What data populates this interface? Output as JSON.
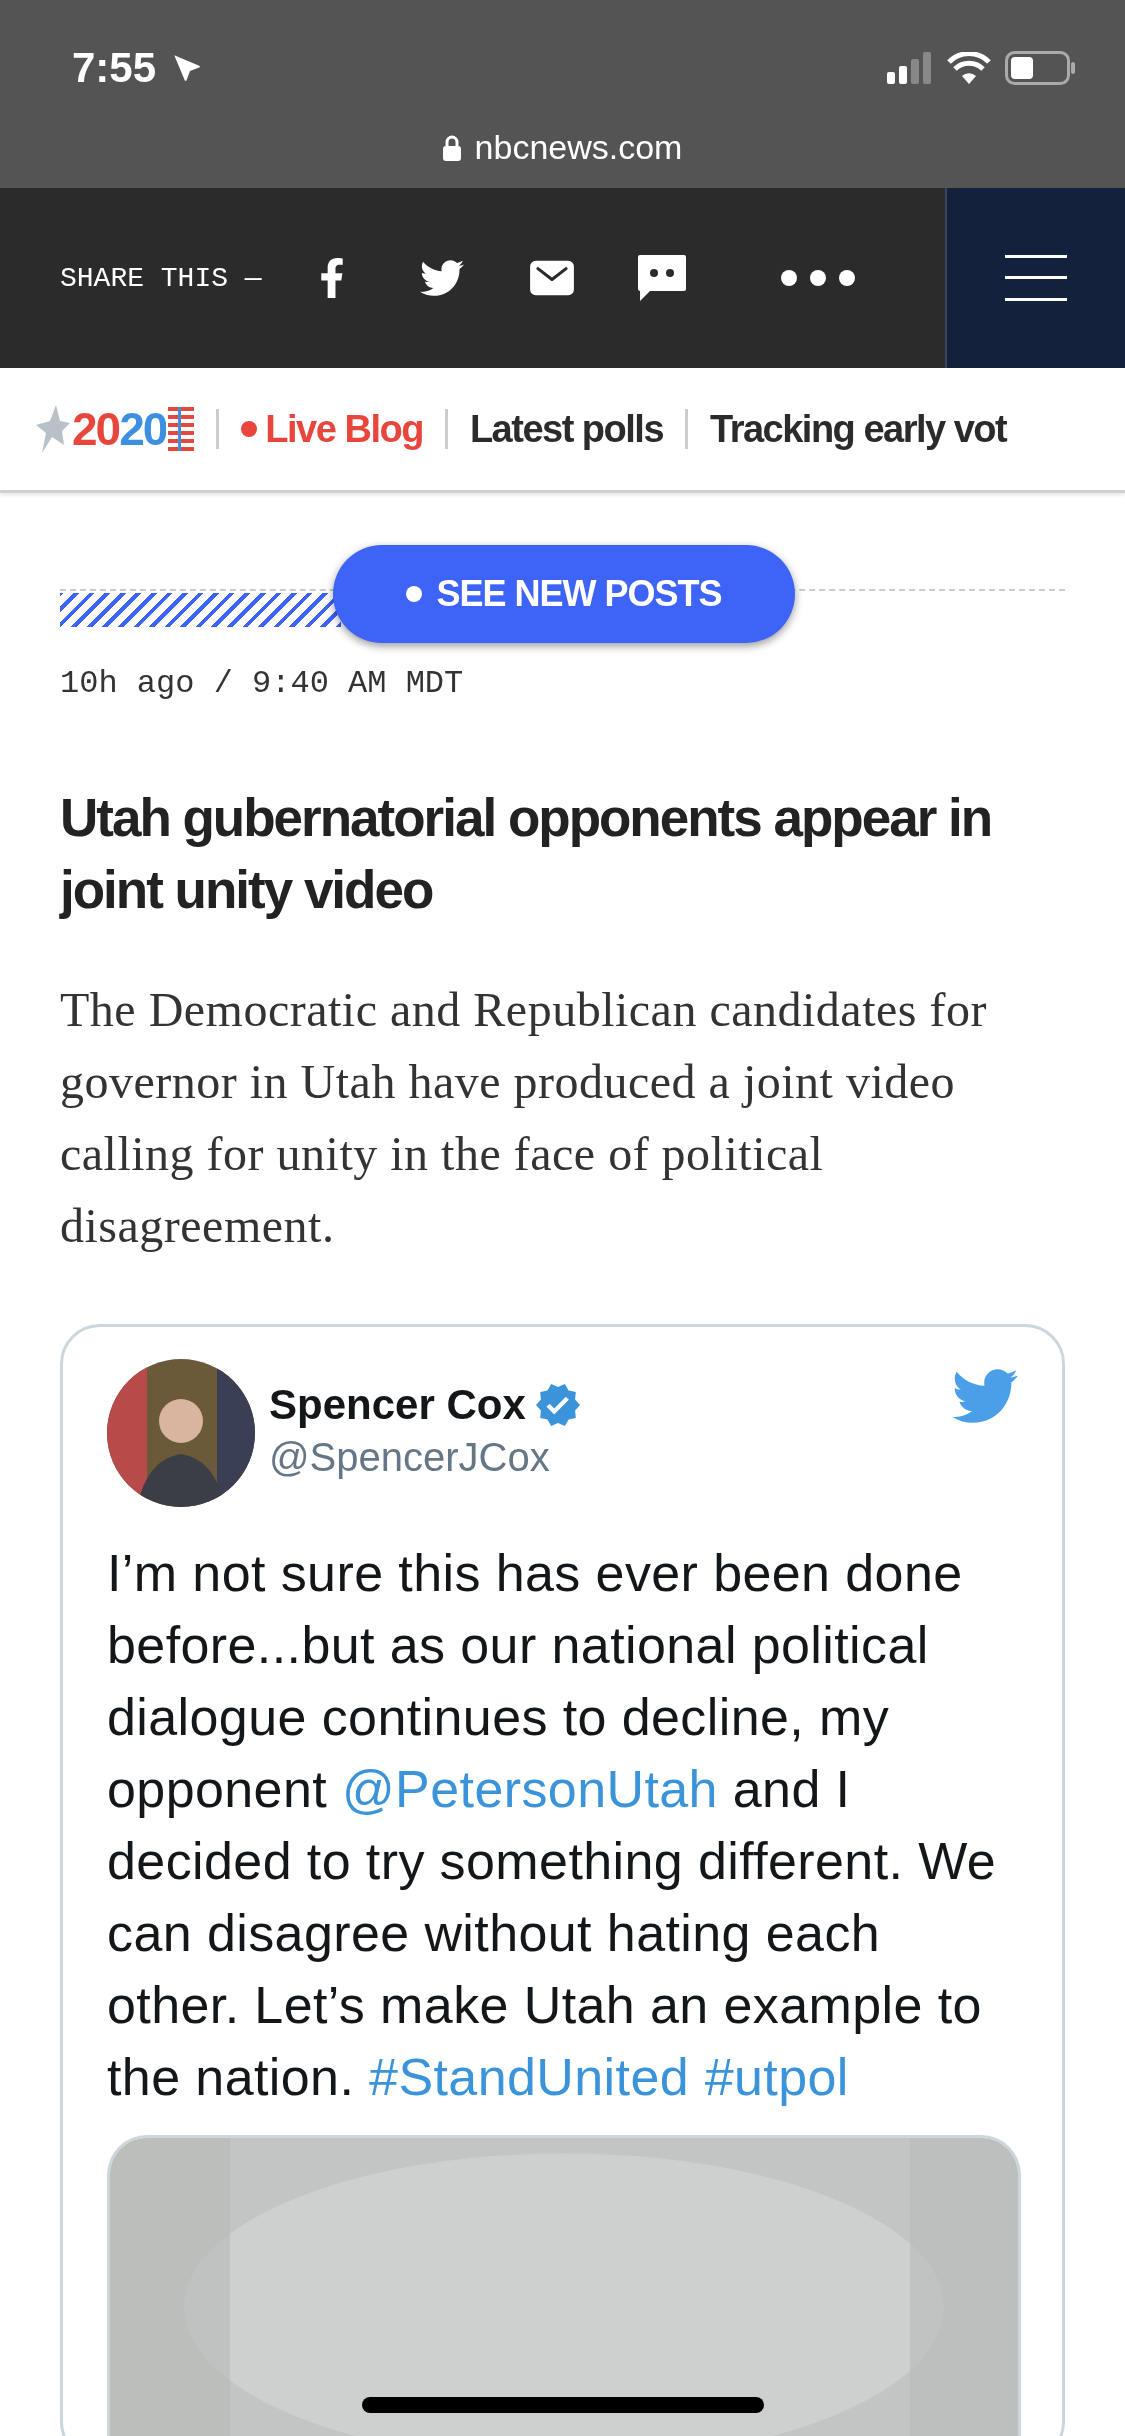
{
  "status_bar": {
    "time": "7:55",
    "url": "nbcnews.com"
  },
  "share_bar": {
    "label": "SHARE THIS —"
  },
  "nav": {
    "logo": "2020",
    "items": [
      {
        "label": "Live Blog",
        "kind": "live"
      },
      {
        "label": "Latest polls",
        "kind": "link"
      },
      {
        "label": "Tracking early vot",
        "kind": "link"
      }
    ]
  },
  "reading_progress": {
    "level": 0.28
  },
  "new_posts_button": "SEE NEW POSTS",
  "post": {
    "timestamp": "10h ago / 9:40 AM MDT",
    "headline": "Utah gubernatorial opponents appear in joint unity video",
    "summary": "The Democratic and Republican candidates for governor in Utah have produced a joint video calling for unity in the face of political disagreement."
  },
  "tweet": {
    "name": "Spencer Cox",
    "verified": true,
    "handle": "@SpencerJCox",
    "segments": [
      {
        "kind": "text",
        "text": "I’m not sure this has ever been done before...but as our national political dialogue continues to decline, my opponent "
      },
      {
        "kind": "link",
        "text": "@PetersonUtah"
      },
      {
        "kind": "text",
        "text": " and I decided to try something different. We can disagree without hating each other. Let’s make Utah an example to the nation. "
      },
      {
        "kind": "link",
        "text": "#StandUnited"
      },
      {
        "kind": "link",
        "text": "#utpol"
      }
    ]
  }
}
